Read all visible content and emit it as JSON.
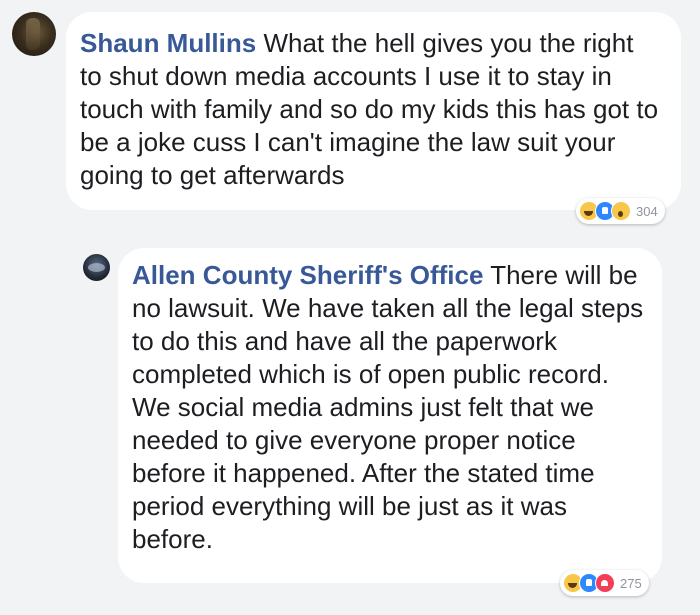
{
  "comments": [
    {
      "author": "Shaun Mullins",
      "text": " What the hell gives you the right to shut down media accounts I use it to stay in touch with family and so do my kids this has got to be a joke cuss I can't imagine the law suit your going to get afterwards",
      "reactions": {
        "icons": [
          "haha-icon",
          "like-icon",
          "wow-icon"
        ],
        "count": "304"
      }
    },
    {
      "author": "Allen County Sheriff's Office",
      "text": " There will be no lawsuit. We have taken all the legal steps to do this and have all the paperwork completed which is of open public record. We social media admins just felt that we needed to give everyone proper notice before it happened. After the stated time period everything will be just as it was before.",
      "reactions": {
        "icons": [
          "haha-icon",
          "like-icon",
          "love-icon"
        ],
        "count": "275"
      }
    }
  ],
  "colors": {
    "background": "#f2f3f5",
    "bubble": "#ffffff",
    "author": "#385898",
    "text": "#1c1e21",
    "count": "#90949c"
  }
}
